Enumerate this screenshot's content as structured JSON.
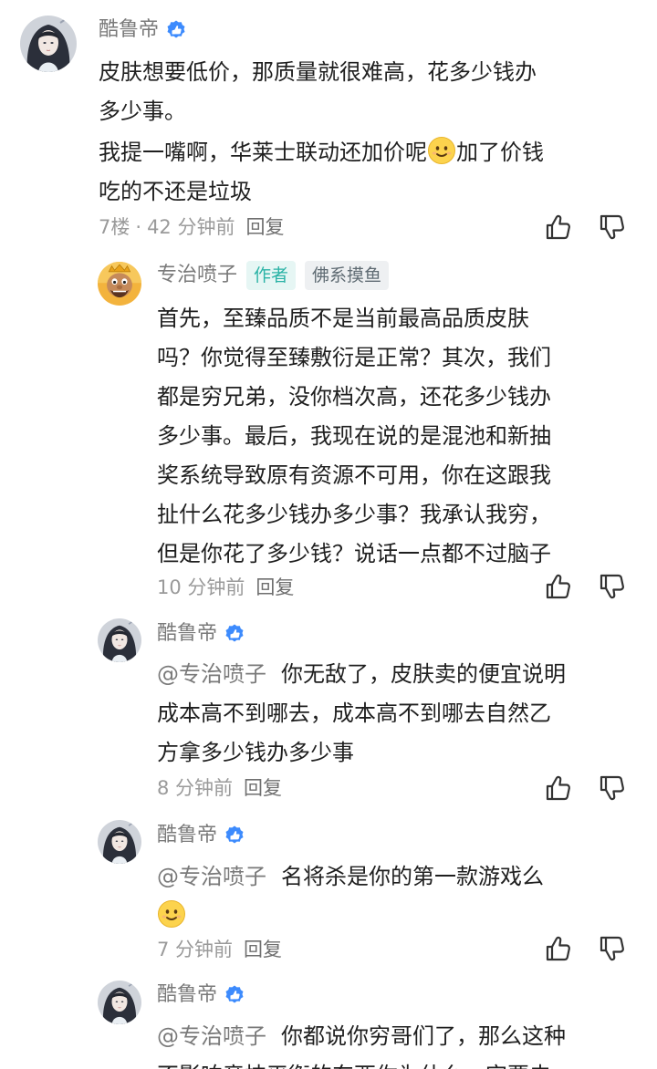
{
  "comments": [
    {
      "author": "酷鲁帝",
      "verified": true,
      "lines": [
        "皮肤想要低价，那质量就很难高，花多少钱办",
        "多少事。"
      ],
      "lines2": [
        "我提一嘴啊，华莱士联动还加价呢",
        "加了价钱",
        "吃的不还是垃圾"
      ],
      "floor": "7楼",
      "dot": "·",
      "time": "42 分钟前",
      "reply": "回复"
    },
    {
      "author": "专治喷子",
      "tag_author": "作者",
      "tag_user": "佛系摸鱼",
      "lines": [
        "首先，至臻品质不是当前最高品质皮肤",
        "吗？你觉得至臻敷衍是正常？其次，我们",
        "都是穷兄弟，没你档次高，还花多少钱办",
        "多少事。最后，我现在说的是混池和新抽",
        "奖系统导致原有资源不可用，你在这跟我",
        "扯什么花多少钱办多少事？我承认我穷，",
        "但是你花了多少钱？说话一点都不过脑子"
      ],
      "time": "10 分钟前",
      "reply": "回复"
    },
    {
      "author": "酷鲁帝",
      "verified": true,
      "mention": "@专治喷子",
      "lines": [
        "你无敌了，皮肤卖的便宜说明",
        "成本高不到哪去，成本高不到哪去自然乙",
        "方拿多少钱办多少事"
      ],
      "time": "8 分钟前",
      "reply": "回复"
    },
    {
      "author": "酷鲁帝",
      "verified": true,
      "mention": "@专治喷子",
      "lines": [
        "名将杀是你的第一款游戏么"
      ],
      "time": "7 分钟前",
      "reply": "回复"
    },
    {
      "author": "酷鲁帝",
      "verified": true,
      "mention": "@专治喷子",
      "lines": [
        "你都说你穷哥们了，那么这种",
        "不影响竞技平衡的东西你为什么一定要去"
      ]
    }
  ],
  "icons": {
    "like": "thumbs-up-icon",
    "dislike": "thumbs-down-icon",
    "verified": "verified-badge-icon",
    "emoji": "smile-emoji-icon"
  },
  "colors": {
    "verified_blue": "#3d8bfd",
    "author_tag": "#2bb3a6",
    "meta_gray": "#9a9a9a"
  }
}
